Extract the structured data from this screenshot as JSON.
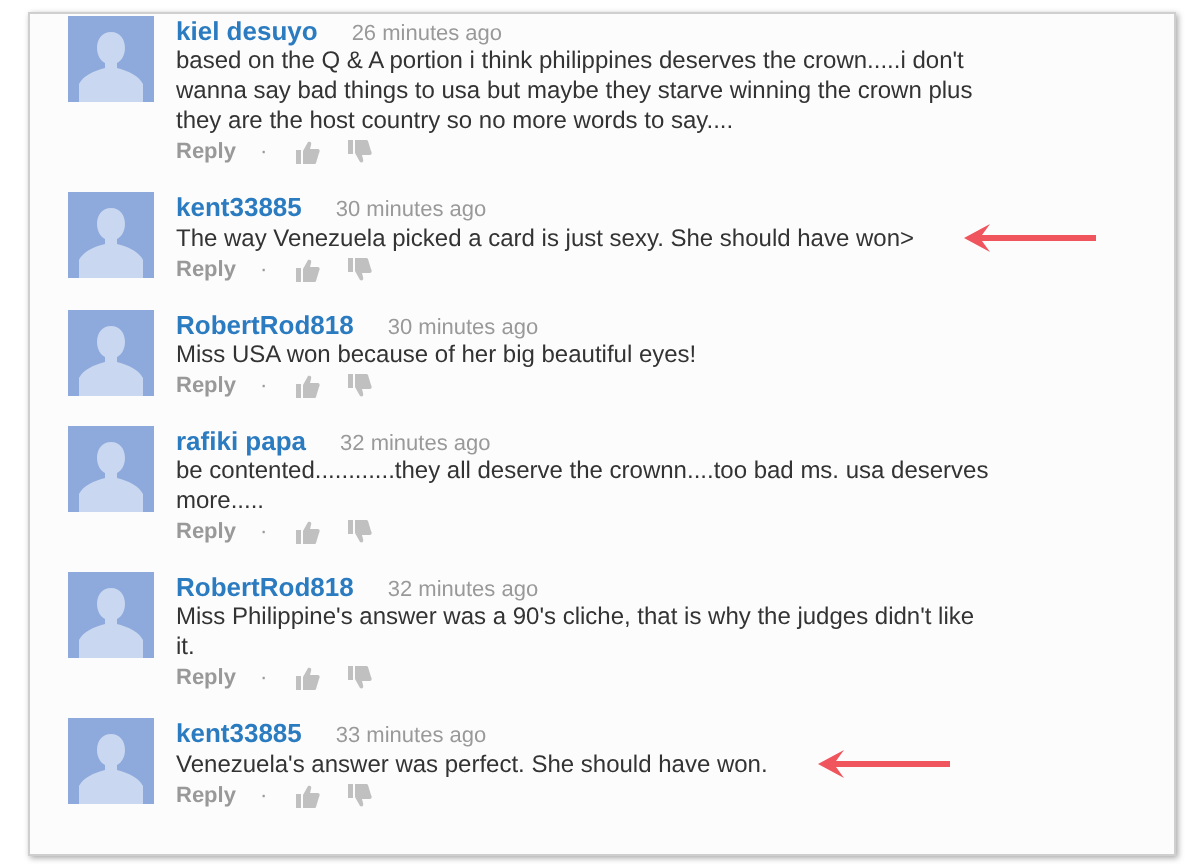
{
  "comments": [
    {
      "author": "kiel desuyo",
      "time": "26 minutes ago",
      "text": "based on the Q & A portion i think philippines deserves the crown.....i don't wanna say bad things to usa but maybe they starve winning the crown plus they are the host country so no more words to say....",
      "reply": "Reply",
      "separator": "·",
      "annotation_arrow": false
    },
    {
      "author": "kent33885",
      "time": "30 minutes ago",
      "text": "The way Venezuela picked a card is just sexy. She should have won>",
      "reply": "Reply",
      "separator": "·",
      "annotation_arrow": true
    },
    {
      "author": "RobertRod818",
      "time": "30 minutes ago",
      "text": "Miss USA won because of her big beautiful eyes!",
      "reply": "Reply",
      "separator": "·",
      "annotation_arrow": false
    },
    {
      "author": "rafiki papa",
      "time": "32 minutes ago",
      "text": "be contented............they all deserve the crownn....too bad ms. usa deserves more.....",
      "reply": "Reply",
      "separator": "·",
      "annotation_arrow": false
    },
    {
      "author": "RobertRod818",
      "time": "32 minutes ago",
      "text": "Miss Philippine's answer was a 90's cliche, that is why the judges didn't like it.",
      "reply": "Reply",
      "separator": "·",
      "annotation_arrow": false
    },
    {
      "author": "kent33885",
      "time": "33 minutes ago",
      "text": "Venezuela's answer was perfect. She should have won.",
      "reply": "Reply",
      "separator": "·",
      "annotation_arrow": true
    }
  ]
}
